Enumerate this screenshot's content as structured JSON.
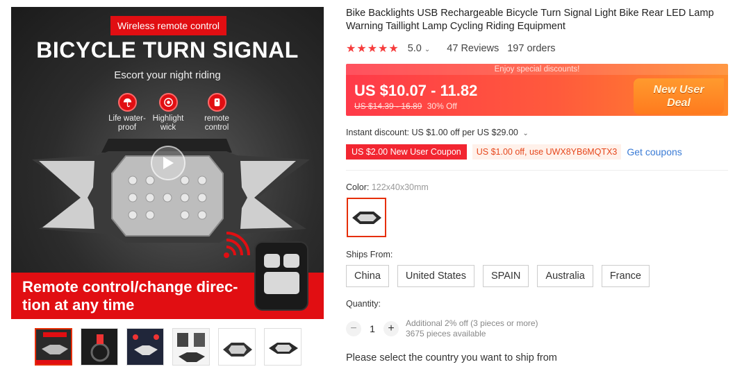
{
  "gallery": {
    "hero": {
      "tag": "Wireless remote control",
      "headline": "BICYCLE TURN SIGNAL",
      "subtitle": "Escort your night riding",
      "features": [
        {
          "icon": "umbrella-icon",
          "label": "Life water-\nproof"
        },
        {
          "icon": "target-icon",
          "label": "Highlight\nwick"
        },
        {
          "icon": "remote-icon",
          "label": "remote\ncontrol"
        }
      ],
      "banner_text": "Remote control/change direc-\ntion at any time"
    },
    "thumbnail_count": 6
  },
  "product": {
    "title": "Bike Backlights USB Rechargeable Bicycle Turn Signal Light Bike Rear LED Lamp Warning Taillight Lamp Cycling Riding Equipment",
    "stars": "★★★★★",
    "rating": "5.0",
    "reviews": "47 Reviews",
    "orders": "197 orders"
  },
  "price": {
    "promo_bar": "Enjoy special discounts!",
    "current": "US $10.07 - 11.82",
    "original": "US $14.39 - 16.89",
    "discount": "30% Off",
    "badge_line1": "New User",
    "badge_line2": "Deal"
  },
  "instant_discount": "Instant discount: US $1.00 off per US $29.00",
  "coupons": {
    "new_user": "US $2.00 New User Coupon",
    "code": "US $1.00 off, use UWX8YB6MQTX3",
    "get": "Get coupons"
  },
  "color": {
    "label": "Color:",
    "value": "122x40x30mm"
  },
  "ships_from": {
    "label": "Ships From:",
    "options": [
      "China",
      "United States",
      "SPAIN",
      "Australia",
      "France"
    ]
  },
  "quantity": {
    "label": "Quantity:",
    "minus": "−",
    "value": "1",
    "plus": "+",
    "note1": "Additional 2% off (3 pieces or more)",
    "note2": "3675 pieces available"
  },
  "ship_message": "Please select the country you want to ship from",
  "colors": {
    "brand_red": "#e10e12",
    "price_red": "#ff3a49",
    "link_blue": "#3a7bd5"
  }
}
